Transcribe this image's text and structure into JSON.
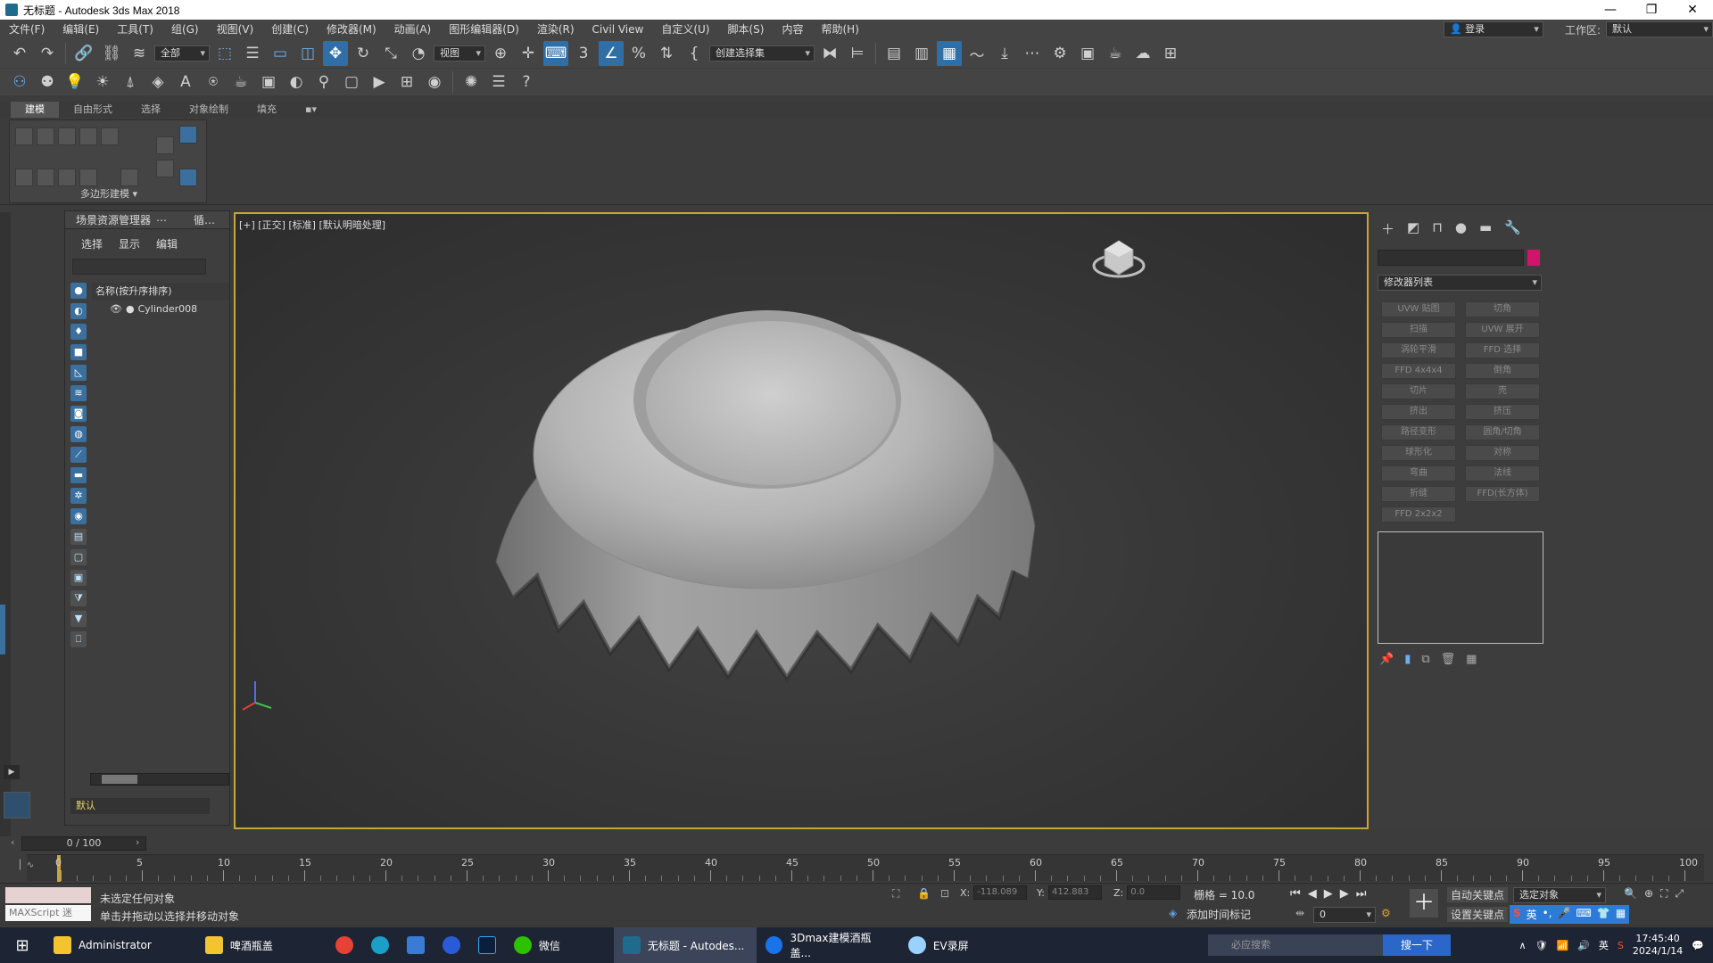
{
  "window": {
    "title": "无标题 - Autodesk 3ds Max 2018",
    "controls": [
      "—",
      "❐",
      "✕"
    ]
  },
  "menu": {
    "items": [
      "文件(F)",
      "编辑(E)",
      "工具(T)",
      "组(G)",
      "视图(V)",
      "创建(C)",
      "修改器(M)",
      "动画(A)",
      "图形编辑器(D)",
      "渲染(R)",
      "Civil View",
      "自定义(U)",
      "脚本(S)",
      "内容",
      "帮助(H)"
    ],
    "login": "登录",
    "workspace_label": "工作区:",
    "workspace_value": "默认"
  },
  "toolbar": {
    "filter_value": "全部",
    "refcoord_value": "视图",
    "selection_set": "创建选择集"
  },
  "ribbon": {
    "tabs": [
      "建模",
      "自由形式",
      "选择",
      "对象绘制",
      "填充"
    ],
    "panel_label": "多边形建模"
  },
  "scene_explorer": {
    "title": "场景资源管理器",
    "title_extra": "循…",
    "tabs": [
      "选择",
      "显示",
      "编辑"
    ],
    "column_header": "名称(按升序排序)",
    "objects": [
      "Cylinder008"
    ],
    "layer": "默认"
  },
  "viewport": {
    "label": "[+] [正交] [标准] [默认明暗处理]",
    "object": "bottle-cap"
  },
  "command_panel": {
    "modifier_list": "修改器列表",
    "modifiers": [
      "UVW 贴图",
      "切角",
      "扫描",
      "UVW 展开",
      "涡轮平滑",
      "FFD 选择",
      "FFD 4x4x4",
      "倒角",
      "切片",
      "壳",
      "挤出",
      "挤压",
      "路径变形",
      "圆角/切角",
      "球形化",
      "对称",
      "弯曲",
      "法线",
      "折缝",
      "FFD(长方体)",
      "FFD 2x2x2"
    ],
    "object_color": "#d2156a"
  },
  "timeline": {
    "frame": "0 / 100",
    "ticks": [
      "0",
      "5",
      "10",
      "15",
      "20",
      "25",
      "30",
      "35",
      "40",
      "45",
      "50",
      "55",
      "60",
      "65",
      "70",
      "75",
      "80",
      "85",
      "90",
      "95",
      "100"
    ]
  },
  "status": {
    "maxscript": "MAXScript 迷",
    "line1": "未选定任何对象",
    "line2": "单击并拖动以选择并移动对象",
    "x_label": "X:",
    "x_value": "-118.089",
    "y_label": "Y:",
    "y_value": "412.883",
    "z_label": "Z:",
    "z_value": "0.0",
    "grid": "栅格 = 10.0",
    "add_time_tag": "添加时间标记",
    "auto_key": "自动关键点",
    "set_key": "设置关键点",
    "key_filter": "选定对象",
    "frame_field": "0"
  },
  "taskbar": {
    "items": [
      "Administrator",
      "啤酒瓶盖",
      "微信",
      "无标题 - Autodes...",
      "3Dmax建模酒瓶盖...",
      "EV录屏"
    ],
    "search_placeholder": "必应搜索",
    "search_button": "搜一下",
    "ime": "英",
    "time": "17:45:40",
    "date": "2024/1/14"
  }
}
